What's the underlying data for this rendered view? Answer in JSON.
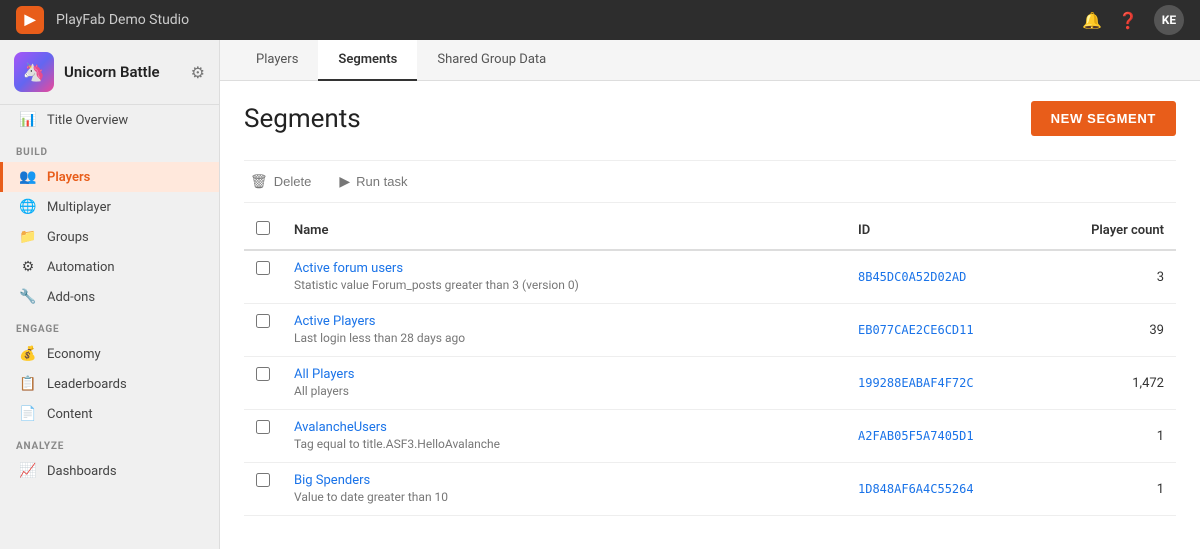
{
  "topBar": {
    "logoText": "▶",
    "title": "PlayFab Demo Studio",
    "avatarText": "KE"
  },
  "sidebar": {
    "gameName": "Unicorn Battle",
    "gameIcon": "🦄",
    "sections": [
      {
        "label": "",
        "items": [
          {
            "id": "title-overview",
            "icon": "📊",
            "label": "Title Overview",
            "active": false
          }
        ]
      },
      {
        "label": "BUILD",
        "items": [
          {
            "id": "players",
            "icon": "👥",
            "label": "Players",
            "active": true
          },
          {
            "id": "multiplayer",
            "icon": "🌐",
            "label": "Multiplayer",
            "active": false
          },
          {
            "id": "groups",
            "icon": "📁",
            "label": "Groups",
            "active": false
          },
          {
            "id": "automation",
            "icon": "⚙",
            "label": "Automation",
            "active": false
          },
          {
            "id": "add-ons",
            "icon": "🔧",
            "label": "Add-ons",
            "active": false
          }
        ]
      },
      {
        "label": "ENGAGE",
        "items": [
          {
            "id": "economy",
            "icon": "💰",
            "label": "Economy",
            "active": false
          },
          {
            "id": "leaderboards",
            "icon": "📋",
            "label": "Leaderboards",
            "active": false
          },
          {
            "id": "content",
            "icon": "📄",
            "label": "Content",
            "active": false
          }
        ]
      },
      {
        "label": "ANALYZE",
        "items": [
          {
            "id": "dashboards",
            "icon": "📈",
            "label": "Dashboards",
            "active": false
          }
        ]
      }
    ]
  },
  "tabs": [
    {
      "id": "players",
      "label": "Players",
      "active": false
    },
    {
      "id": "segments",
      "label": "Segments",
      "active": true
    },
    {
      "id": "shared-group-data",
      "label": "Shared Group Data",
      "active": false
    }
  ],
  "page": {
    "title": "Segments",
    "newSegmentButton": "NEW SEGMENT"
  },
  "toolbar": {
    "deleteLabel": "Delete",
    "runTaskLabel": "Run task"
  },
  "table": {
    "columns": {
      "name": "Name",
      "id": "ID",
      "playerCount": "Player count"
    },
    "rows": [
      {
        "id": "row-1",
        "name": "Active forum users",
        "description": "Statistic value Forum_posts greater than 3 (version 0)",
        "segmentId": "8B45DC0A52D02AD",
        "playerCount": "3"
      },
      {
        "id": "row-2",
        "name": "Active Players",
        "description": "Last login less than 28 days ago",
        "segmentId": "EB077CAE2CE6CD11",
        "playerCount": "39"
      },
      {
        "id": "row-3",
        "name": "All Players",
        "description": "All players",
        "segmentId": "199288EABAF4F72C",
        "playerCount": "1,472"
      },
      {
        "id": "row-4",
        "name": "AvalancheUsers",
        "description": "Tag equal to title.ASF3.HelloAvalanche",
        "segmentId": "A2FAB05F5A7405D1",
        "playerCount": "1"
      },
      {
        "id": "row-5",
        "name": "Big Spenders",
        "description": "Value to date greater than 10",
        "segmentId": "1D848AF6A4C55264",
        "playerCount": "1"
      }
    ]
  }
}
